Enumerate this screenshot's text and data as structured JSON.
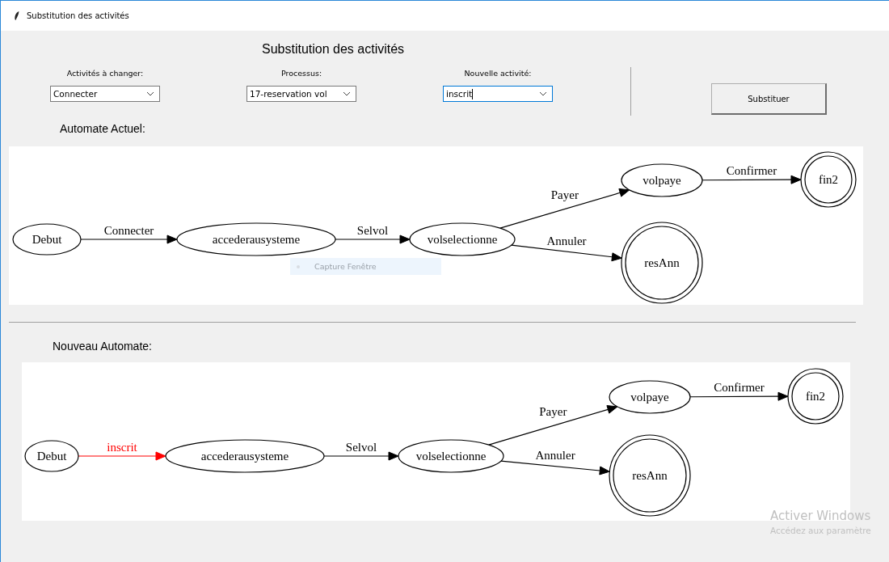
{
  "window": {
    "title": "Substitution des activités"
  },
  "heading": "Substitution des activités",
  "fields": [
    {
      "label": "Activités à changer:",
      "value": "Connecter",
      "focused": false
    },
    {
      "label": "Processus:",
      "value": "17-reservation vol",
      "focused": false
    },
    {
      "label": "Nouvelle activité:",
      "value": "inscrit",
      "focused": true
    }
  ],
  "submit_button": "Substituer",
  "graphs": [
    {
      "title": "Automate Actuel:",
      "nodes": [
        {
          "label": "Debut",
          "kind": "state"
        },
        {
          "label": "accederausysteme",
          "kind": "state"
        },
        {
          "label": "volselectionne",
          "kind": "state"
        },
        {
          "label": "volpaye",
          "kind": "state"
        },
        {
          "label": "fin2",
          "kind": "final"
        },
        {
          "label": "resAnn",
          "kind": "final"
        }
      ],
      "edges": [
        {
          "label": "Connecter",
          "highlighted": false
        },
        {
          "label": "Selvol",
          "highlighted": false
        },
        {
          "label": "Payer",
          "highlighted": false
        },
        {
          "label": "Annuler",
          "highlighted": false
        },
        {
          "label": "Confirmer",
          "highlighted": false
        }
      ]
    },
    {
      "title": "Nouveau Automate:",
      "nodes": [
        {
          "label": "Debut",
          "kind": "state"
        },
        {
          "label": "accederausysteme",
          "kind": "state"
        },
        {
          "label": "volselectionne",
          "kind": "state"
        },
        {
          "label": "volpaye",
          "kind": "state"
        },
        {
          "label": "fin2",
          "kind": "final"
        },
        {
          "label": "resAnn",
          "kind": "final"
        }
      ],
      "edges": [
        {
          "label": "inscrit",
          "highlighted": true
        },
        {
          "label": "Selvol",
          "highlighted": false
        },
        {
          "label": "Payer",
          "highlighted": false
        },
        {
          "label": "Annuler",
          "highlighted": false
        },
        {
          "label": "Confirmer",
          "highlighted": false
        }
      ]
    }
  ],
  "tooltip": "Capture Fenêtre",
  "activation_notice": {
    "title": "Activer Windows",
    "text": "Accédez aux paramètre"
  }
}
